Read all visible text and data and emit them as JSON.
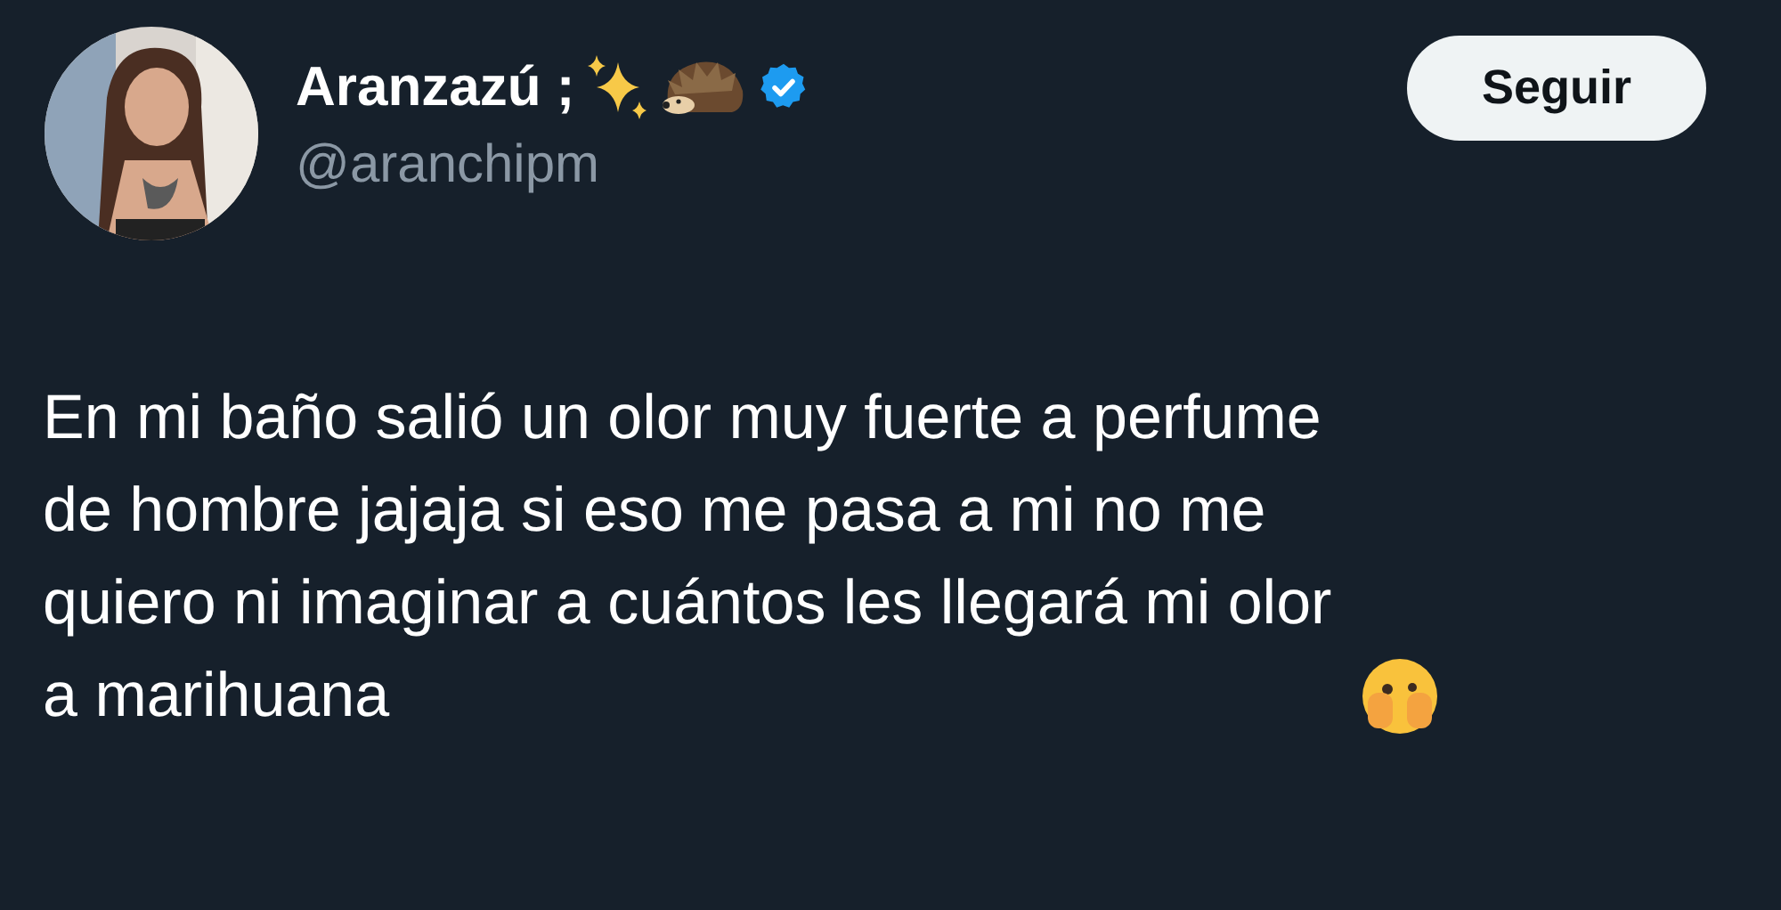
{
  "author": {
    "name": "Aranzazú ;",
    "handle": "@aranchipm",
    "verified": true
  },
  "follow_button": {
    "label": "Seguir"
  },
  "tweet": {
    "lines": [
      "En mi baño salió un olor muy fuerte a perfume",
      "de hombre jajaja si eso me pasa a mi no me",
      "quiero ni imaginar a cuántos les llegará mi olor",
      "a marihuana"
    ]
  }
}
